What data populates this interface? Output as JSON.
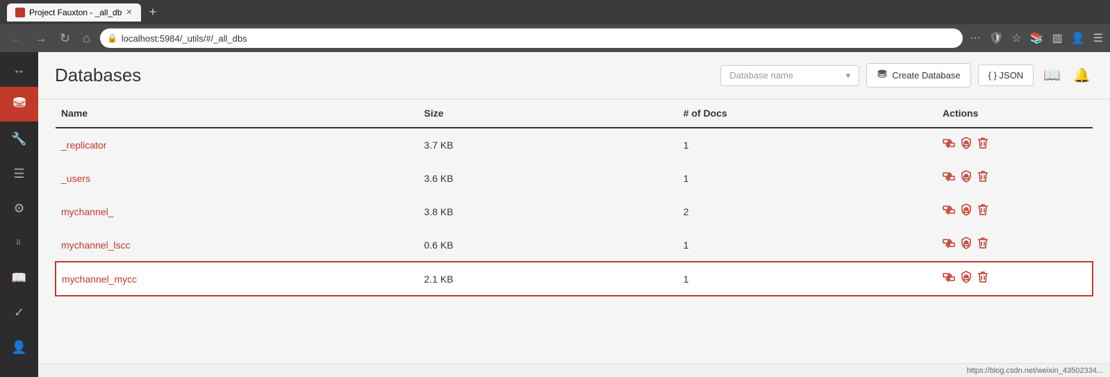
{
  "browser": {
    "tab_title": "Project Fauxton - _all_db",
    "tab_favicon": "red",
    "url": "localhost:5984/_utils/#/_all_dbs",
    "url_protocol": "localhost:",
    "url_path": "5984/_utils/#/_all_dbs",
    "new_tab_label": "+"
  },
  "page": {
    "title": "Databases",
    "db_name_placeholder": "Database name",
    "create_db_button": "Create Database",
    "json_button": "{ } JSON"
  },
  "table": {
    "columns": {
      "name": "Name",
      "size": "Size",
      "docs": "# of Docs",
      "actions": "Actions"
    },
    "rows": [
      {
        "name": "_replicator",
        "size": "3.7 KB",
        "docs": "1",
        "highlighted": false
      },
      {
        "name": "_users",
        "size": "3.6 KB",
        "docs": "1",
        "highlighted": false
      },
      {
        "name": "mychannel_",
        "size": "3.8 KB",
        "docs": "2",
        "highlighted": false
      },
      {
        "name": "mychannel_lscc",
        "size": "0.6 KB",
        "docs": "1",
        "highlighted": false
      },
      {
        "name": "mychannel_mycc",
        "size": "2.1 KB",
        "docs": "1",
        "highlighted": true
      }
    ]
  },
  "sidebar": {
    "items": [
      {
        "id": "back",
        "icon": "↔",
        "label": "back-icon",
        "active": false
      },
      {
        "id": "database",
        "icon": "db",
        "label": "database-icon",
        "active": true
      },
      {
        "id": "wrench",
        "icon": "🔧",
        "label": "wrench-icon",
        "active": false
      },
      {
        "id": "list",
        "icon": "≡",
        "label": "list-icon",
        "active": false
      },
      {
        "id": "gear",
        "icon": "⚙",
        "label": "gear-icon",
        "active": false
      },
      {
        "id": "dots",
        "icon": "⠿",
        "label": "dots-icon",
        "active": false
      },
      {
        "id": "book",
        "icon": "📖",
        "label": "book-icon",
        "active": false
      },
      {
        "id": "check",
        "icon": "✓",
        "label": "check-icon",
        "active": false
      },
      {
        "id": "person",
        "icon": "👤",
        "label": "person-icon",
        "active": false
      }
    ]
  },
  "status_bar": {
    "url_hint": "https://blog.csdn.net/weixin_43502334..."
  }
}
